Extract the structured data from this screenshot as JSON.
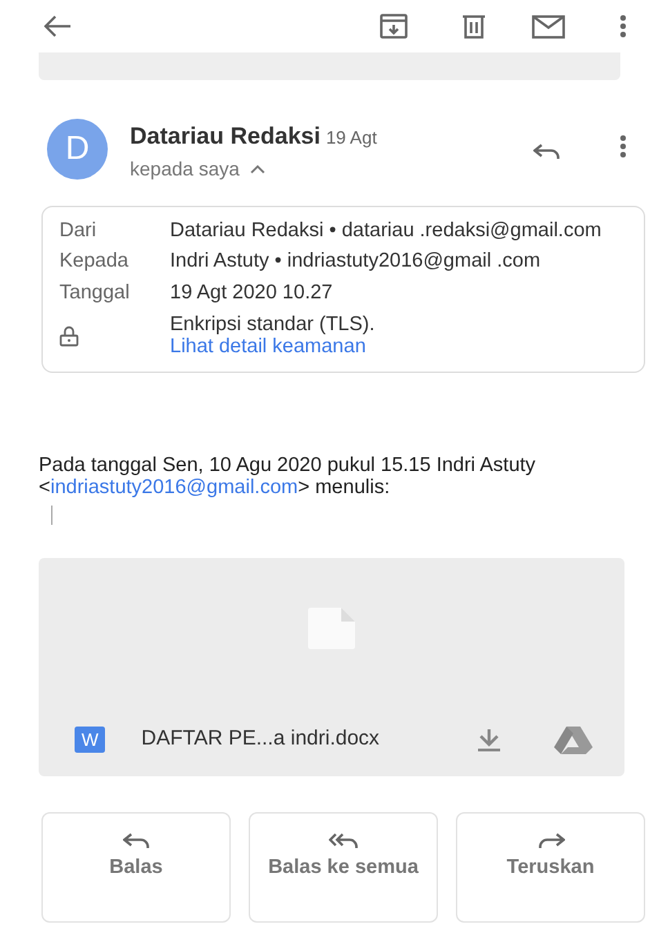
{
  "toolbar": {
    "actions": [
      {
        "kind": "archive"
      },
      {
        "kind": "delete"
      },
      {
        "kind": "mail"
      },
      {
        "kind": "more"
      }
    ]
  },
  "message": {
    "avatar": "D",
    "sender": "Datariau Redaksi",
    "date": "19 Agt",
    "recipient": "kepada saya",
    "expanded": true
  },
  "details": [
    {
      "kind": "field",
      "label": "Dari",
      "value": "Datariau Redaksi • datariau .redaksi@gmail.com"
    },
    {
      "kind": "field",
      "label": "Kepada",
      "value": "Indri Astuty • indriastuty2016@gmail .com"
    },
    {
      "kind": "field",
      "label": "Tanggal",
      "value": "19 Agt 2020 10.27"
    },
    {
      "kind": "security",
      "value": "Enkripsi standar (TLS).",
      "link": "Lihat detail keamanan"
    }
  ],
  "quote": {
    "before": "Pada tanggal Sen, 10 Agu 2020 pukul 15.15 Indri Astuty <",
    "email": "indriastuty2016@gmail.com",
    "after": "> menulis:"
  },
  "attachment": {
    "badge": "W",
    "filename": "DAFTAR PE...a indri.docx"
  },
  "actions": [
    {
      "kind": "reply",
      "label": "Balas"
    },
    {
      "kind": "reply_all",
      "label": "Balas ke semua"
    },
    {
      "kind": "forward",
      "label": "Teruskan"
    }
  ]
}
